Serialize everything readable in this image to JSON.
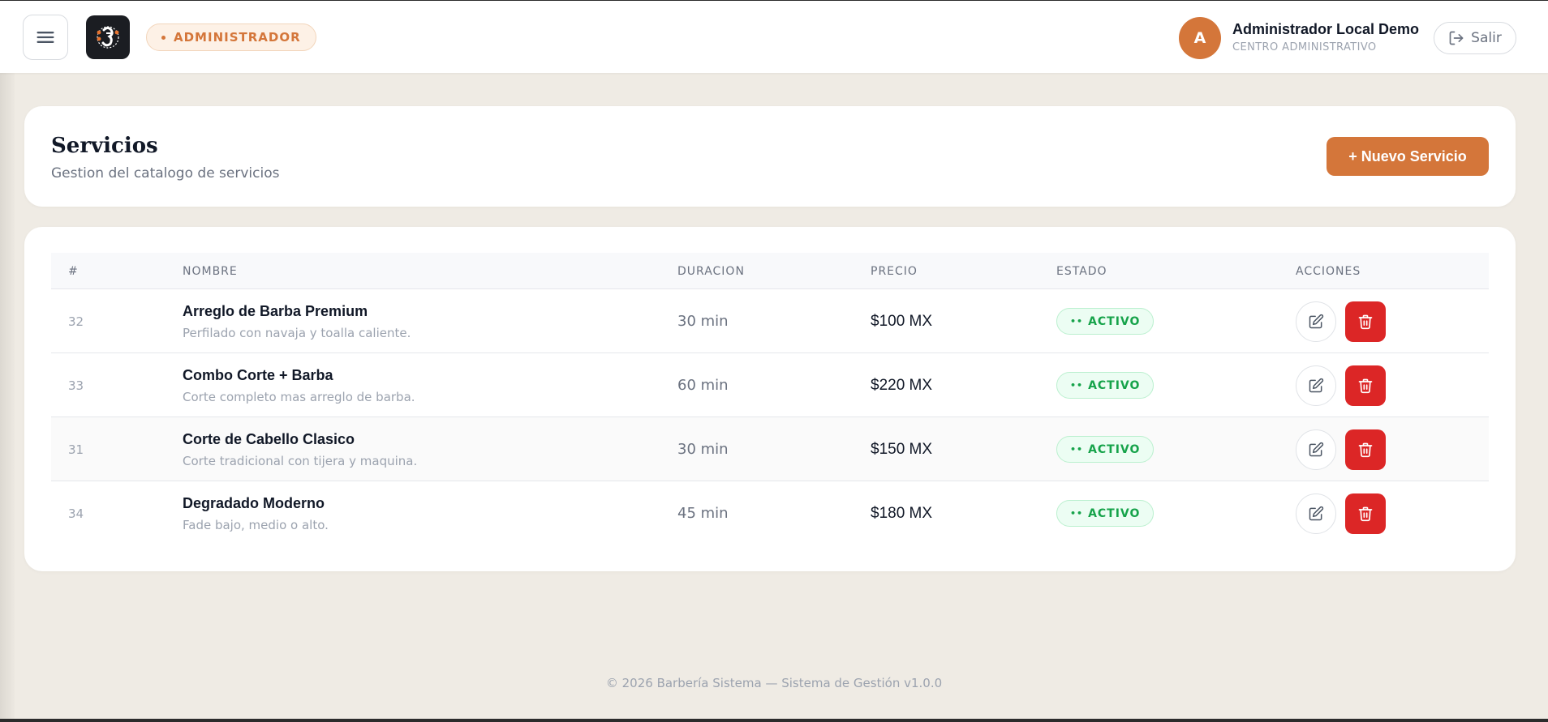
{
  "topbar": {
    "role_label": "ADMINISTRADOR",
    "user_initial": "A",
    "user_name": "Administrador Local Demo",
    "user_role": "CENTRO ADMINISTRATIVO",
    "logout_label": "Salir"
  },
  "page": {
    "title": "Servicios",
    "subtitle": "Gestion del catalogo de servicios",
    "new_button": "+ Nuevo Servicio"
  },
  "table": {
    "headers": {
      "id": "#",
      "name": "NOMBRE",
      "duration": "DURACION",
      "price": "PRECIO",
      "status": "ESTADO",
      "actions": "ACCIONES"
    },
    "rows": [
      {
        "id": "32",
        "name": "Arreglo de Barba Premium",
        "description": "Perfilado con navaja y toalla caliente.",
        "duration": "30 min",
        "price": "$100 MX",
        "status": "ACTIVO"
      },
      {
        "id": "33",
        "name": "Combo Corte + Barba",
        "description": "Corte completo mas arreglo de barba.",
        "duration": "60 min",
        "price": "$220 MX",
        "status": "ACTIVO"
      },
      {
        "id": "31",
        "name": "Corte de Cabello Clasico",
        "description": "Corte tradicional con tijera y maquina.",
        "duration": "30 min",
        "price": "$150 MX",
        "status": "ACTIVO"
      },
      {
        "id": "34",
        "name": "Degradado Moderno",
        "description": "Fade bajo, medio o alto.",
        "duration": "45 min",
        "price": "$180 MX",
        "status": "ACTIVO"
      }
    ]
  },
  "footer": {
    "text": "© 2026 Barbería Sistema — Sistema de Gestión v1.0.0"
  },
  "colors": {
    "accent": "#d4763a",
    "danger": "#dc2626",
    "success": "#16a34a",
    "background": "#efebe4"
  },
  "icons": {
    "menu": "hamburger-menu-icon",
    "logo": "barberia-logo",
    "logout": "logout-arrow-icon",
    "edit": "pencil-square-icon",
    "delete": "trash-icon"
  }
}
